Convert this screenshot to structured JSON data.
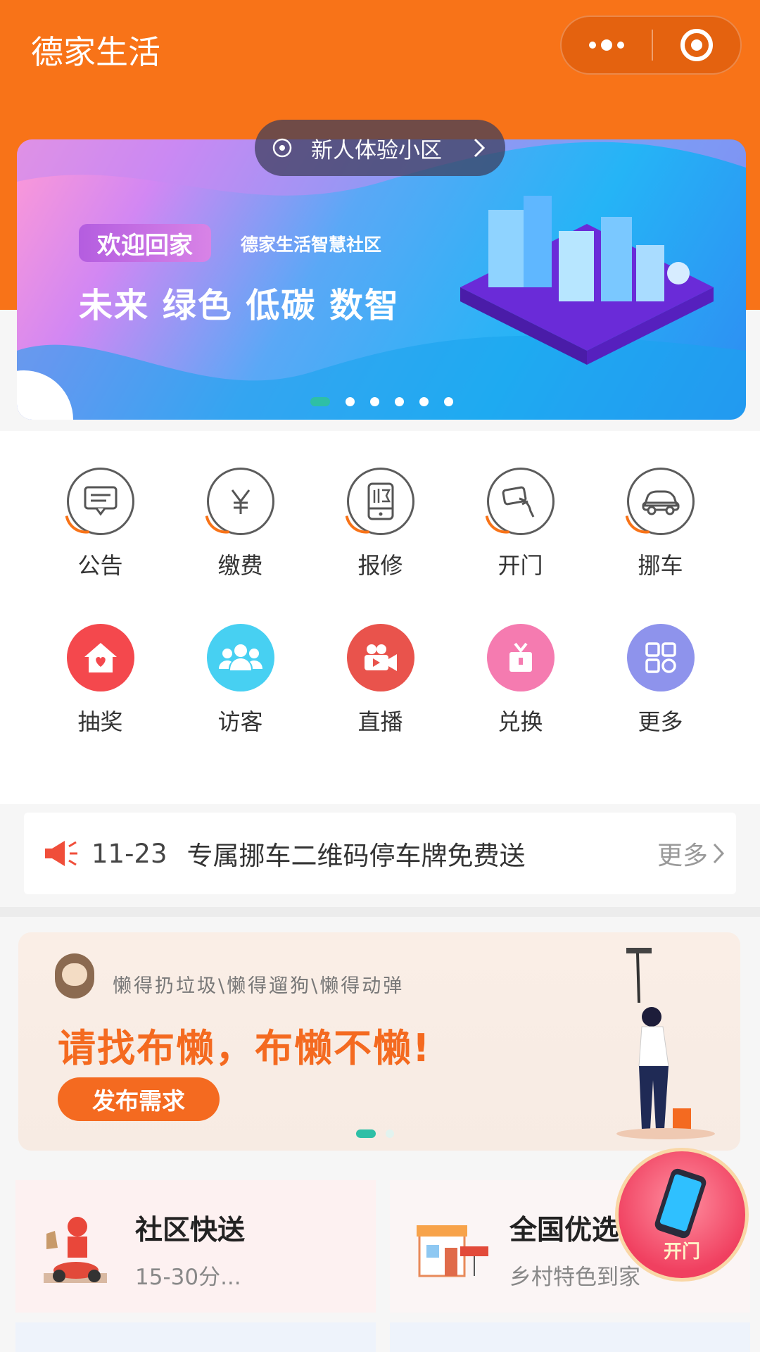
{
  "header": {
    "title": "德家生活",
    "more_icon": "ellipsis-icon",
    "close_icon": "target-circle-icon",
    "brand_color": "#f87318"
  },
  "community": {
    "label": "新人体验小区",
    "icon": "location-dot-icon"
  },
  "banner": {
    "chip": "欢迎回家",
    "subtitle": "德家生活智慧社区",
    "slogan": "未来 绿色 低碳 数智",
    "dot_count": 6,
    "active_dot": 0
  },
  "services": {
    "row1": [
      {
        "label": "公告",
        "icon": "announcement-icon"
      },
      {
        "label": "缴费",
        "icon": "yuan-icon"
      },
      {
        "label": "报修",
        "icon": "repair-icon"
      },
      {
        "label": "开门",
        "icon": "door-card-icon"
      },
      {
        "label": "挪车",
        "icon": "car-icon"
      }
    ],
    "row2": [
      {
        "label": "抽奖",
        "icon": "house-heart-icon",
        "color": "#f4484d"
      },
      {
        "label": "访客",
        "icon": "visitors-icon",
        "color": "#47d0f2"
      },
      {
        "label": "直播",
        "icon": "video-camera-icon",
        "color": "#e9534c"
      },
      {
        "label": "兑换",
        "icon": "gift-icon",
        "color": "#f57bb0"
      },
      {
        "label": "更多",
        "icon": "grid-icon",
        "color": "#8e93ec"
      }
    ]
  },
  "notice": {
    "icon": "megaphone-icon",
    "date": "11-23",
    "text": "专属挪车二维码停车牌免费送",
    "more": "更多"
  },
  "promo": {
    "tags": "懒得扔垃圾\\懒得遛狗\\懒得动弹",
    "headline": "请找布懒，布懒不懒!",
    "button": "发布需求",
    "dot_count": 2,
    "active_dot": 0
  },
  "cards": [
    {
      "title": "社区快送",
      "subtitle": "15-30分..."
    },
    {
      "title": "全国优选",
      "subtitle": "乡村特色到家"
    }
  ],
  "fab": {
    "label": "开门",
    "icon": "phone-key-icon"
  }
}
